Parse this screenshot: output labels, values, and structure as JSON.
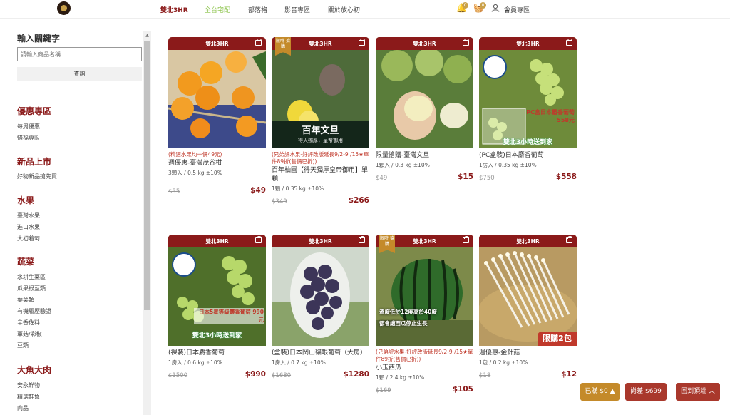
{
  "nav": {
    "items": [
      "雙北3HR",
      "全台宅配",
      "部落格",
      "影音專區",
      "關於放心初"
    ],
    "cart_count": "0",
    "notice_count": "0",
    "member": "會員專區"
  },
  "sidebar": {
    "search_title": "輸入關鍵字",
    "search_placeholder": "請輸入商品名稱",
    "search_button": "查詢",
    "categories": [
      {
        "title": "優惠專區",
        "items": [
          "每周優惠",
          "惜福專區"
        ]
      },
      {
        "title": "新品上市",
        "items": [
          "好物新品搶先買"
        ]
      },
      {
        "title": "水果",
        "items": [
          "臺灣水果",
          "進口水果",
          "大初着萄"
        ]
      },
      {
        "title": "蔬菜",
        "items": [
          "水耕生菜區",
          "瓜果根莖類",
          "葉菜類",
          "有機履歷驗證",
          "辛香佐料",
          "蕈菇/彩椒",
          "豆類"
        ]
      },
      {
        "title": "大魚大肉",
        "items": [
          "安永鮮物",
          "精選鮭魚",
          "肉品"
        ]
      }
    ]
  },
  "colors": {
    "brand": "#8b1a1a",
    "gold": "#c48a2a",
    "sale": "#c0392b"
  },
  "products": [
    {
      "bar": "雙北3HR",
      "tag": "",
      "promo": "(精選水果均一價49元)",
      "name": "週優惠-臺灣茂谷柑",
      "spec": "3顆入 / 0.5 kg ±10%",
      "orig": "$55",
      "price": "$49",
      "art": "orange"
    },
    {
      "bar": "雙北3HR",
      "tag": "限時 搶購",
      "promo": "(兄弟評水果-好評改版延長9/2-9 /15★單件89折(售價已折))",
      "name": "百年柚園【得天獨厚皇帝御用】單顆",
      "spec": "1顆 / 0.35 kg ±10%",
      "orig": "$349",
      "price": "$266",
      "art": "pomelo",
      "overlay_big": "百年文旦",
      "overlay_small": "得天獨厚，皇帝御用"
    },
    {
      "bar": "雙北3HR",
      "tag": "",
      "promo": "",
      "name": "限量搶購-臺灣文旦",
      "spec": "1顆入 / 0.3 kg ±10%",
      "orig": "$49",
      "price": "$15",
      "art": "pomelo2"
    },
    {
      "bar": "雙北3HR",
      "tag": "",
      "promo": "",
      "name": "(PC盒裝)日本麝香葡萄",
      "spec": "1房入 / 0.35 kg ±10%",
      "orig": "$750",
      "price": "$558",
      "art": "grape",
      "overlay_big": "PC盒日本麝香葡萄 558元",
      "overlay_small": "雙北3小時送到家"
    },
    {
      "bar": "雙北3HR",
      "tag": "",
      "promo": "",
      "name": "(裸裝)日本麝香葡萄",
      "spec": "1房入 / 0.6 kg ±10%",
      "orig": "$1500",
      "price": "$990",
      "art": "grape2",
      "overlay_big": "日本5星等級麝香葡萄 990元",
      "overlay_small": "雙北3小時送到家"
    },
    {
      "bar": "雙北3HR",
      "tag": "",
      "promo": "",
      "name": "(盒裝)日本岡山貓眼葡萄（大房）",
      "spec": "1房入 / 0.7 kg ±10%",
      "orig": "$1680",
      "price": "$1280",
      "art": "darkgrape"
    },
    {
      "bar": "雙北3HR",
      "tag": "限時 搶購",
      "promo": "(兄弟評水果-好評改版延長9/2-9 /15★單件89折(售價已折))",
      "name": "小玉西瓜",
      "spec": "1顆 / 2.4 kg ±10%",
      "orig": "$169",
      "price": "$105",
      "art": "melon",
      "overlay_big": "溫度低於12度高於40度",
      "overlay_small": "都會讓西瓜停止生長"
    },
    {
      "bar": "雙北3HR",
      "tag": "",
      "promo": "",
      "name": "週優惠-金針菇",
      "spec": "1包 / 0.2 kg ±10%",
      "orig": "$18",
      "price": "$12",
      "art": "mushroom",
      "limit": "限購2包"
    }
  ],
  "floating": {
    "bought": "已購 $0 ▲",
    "diff": "尚差 $699",
    "top": "回到頂端 ︿"
  }
}
